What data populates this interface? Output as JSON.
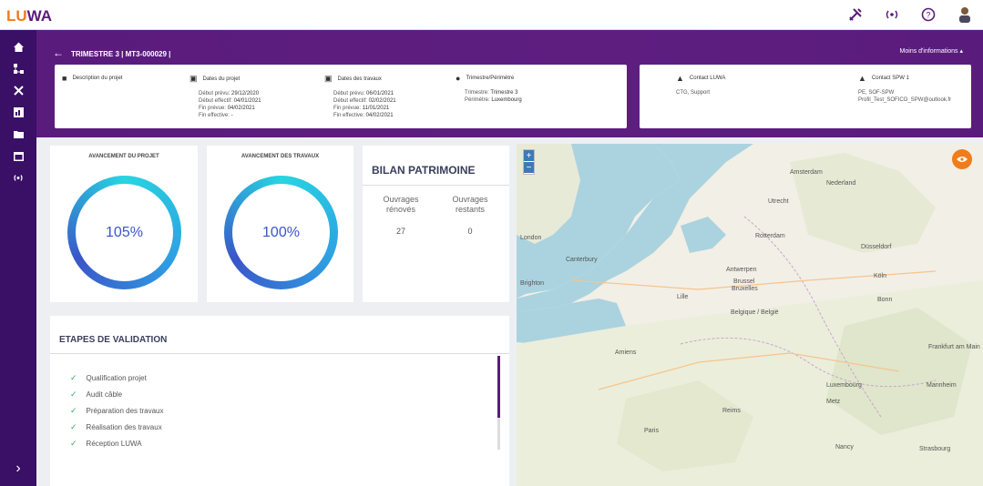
{
  "app": {
    "logo_a": "LU",
    "logo_b": "WA"
  },
  "topbar": {
    "icons": [
      "tools-icon",
      "broadcast-icon",
      "help-icon",
      "user-icon"
    ]
  },
  "sidebar": {
    "items": [
      "home-icon",
      "network-icon",
      "tools-icon",
      "chart-icon",
      "folder-icon",
      "calendar-icon",
      "broadcast-icon"
    ]
  },
  "header": {
    "title": "TRIMESTRE 3 | MT3-000029 |",
    "more": "Moins d'informations",
    "desc_title": "Description du projet",
    "dates_projet": {
      "title": "Dates du projet",
      "lines": [
        {
          "label": "Début prévu:",
          "value": "29/12/2020"
        },
        {
          "label": "Début effectif:",
          "value": "04/01/2021"
        },
        {
          "label": "Fin prévue:",
          "value": "04/02/2021"
        },
        {
          "label": "Fin effective:",
          "value": "-"
        }
      ]
    },
    "dates_travaux": {
      "title": "Dates des travaux",
      "lines": [
        {
          "label": "Début prévu:",
          "value": "06/01/2021"
        },
        {
          "label": "Début effectif:",
          "value": "02/02/2021"
        },
        {
          "label": "Fin prévue:",
          "value": "11/01/2021"
        },
        {
          "label": "Fin effective:",
          "value": "04/02/2021"
        }
      ]
    },
    "trimestre": {
      "title": "Trimestre/Périmètre",
      "lines": [
        {
          "label": "Trimestre:",
          "value": "Trimestre 3"
        },
        {
          "label": "Périmètre:",
          "value": "Luxembourg"
        }
      ]
    },
    "contact_luwa": {
      "title": "Contact LUWA",
      "lines": [
        "CTG, Support"
      ]
    },
    "contact_spw": {
      "title": "Contact SPW 1",
      "lines": [
        "PE, SOF-SPW",
        "Profil_Test_SOFICO_SPW@outlook.fr"
      ]
    }
  },
  "kpi": {
    "projet": {
      "title": "AVANCEMENT DU PROJET",
      "value": "105%"
    },
    "travaux": {
      "title": "AVANCEMENT DES TRAVAUX",
      "value": "100%"
    }
  },
  "bilan": {
    "title": "BILAN PATRIMOINE",
    "col1_l1": "Ouvrages",
    "col1_l2": "rénovés",
    "col1_value": "27",
    "col2_l1": "Ouvrages",
    "col2_l2": "restants",
    "col2_value": "0"
  },
  "etapes": {
    "title": "ETAPES DE VALIDATION",
    "items": [
      "Qualification projet",
      "Audit câble",
      "Préparation des travaux",
      "Réalisation des travaux",
      "Réception LUWA"
    ]
  },
  "map": {
    "zoom_in": "+",
    "zoom_out": "−",
    "labels": [
      "Nederland",
      "Amsterdam",
      "Utrecht",
      "Antwerpen",
      "Brussel",
      "Bruxelles",
      "Belgique / België",
      "Düsseldorf",
      "Köln",
      "Lille",
      "London",
      "Canterbury",
      "Brighton",
      "Amiens",
      "Paris",
      "Reims",
      "Luxembourg",
      "Frankfurt am Main",
      "Mannheim",
      "Nancy",
      "Strasbourg",
      "Rotterdam",
      "Bonn",
      "Metz"
    ]
  },
  "colors": {
    "accent": "#5b1b7e",
    "brand_orange": "#f07c1b",
    "sidebar": "#3a0f66",
    "ring_start": "#3a55c8",
    "ring_end": "#28d5e0"
  }
}
